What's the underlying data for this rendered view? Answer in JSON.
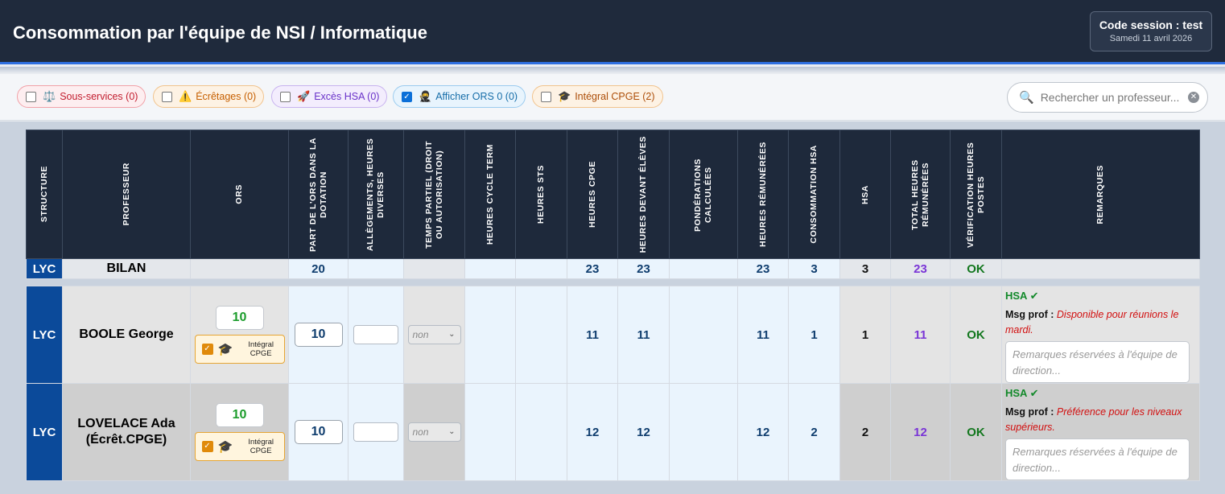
{
  "header": {
    "title": "Consommation par l'équipe de NSI / Informatique",
    "session_code": "Code session : test",
    "session_date": "Samedi 11 avril 2026"
  },
  "filters": [
    {
      "label": "Sous-services (0)",
      "icon": "balance-scale-icon",
      "checked": false,
      "color": "#c21d2e"
    },
    {
      "label": "Écrêtages (0)",
      "icon": "warning-icon",
      "checked": false,
      "color": "#c65f00"
    },
    {
      "label": "Excès HSA (0)",
      "icon": "rocket-icon",
      "checked": false,
      "color": "#6a32c9"
    },
    {
      "label": "Afficher ORS 0 (0)",
      "icon": "ninja-icon",
      "checked": true,
      "color": "#176ea9"
    },
    {
      "label": "Intégral CPGE (2)",
      "icon": "graduation-cap-icon",
      "checked": false,
      "color": "#ad4f0a"
    }
  ],
  "search": {
    "placeholder": "Rechercher un professeur..."
  },
  "columns": [
    "Structure",
    "Professeur",
    "ORS",
    "Part de l'ORS dans la dotation",
    "Allègements, heures diverses",
    "Temps partiel (droit ou autorisation)",
    "Heures cycle term",
    "Heures STS",
    "Heures CPGE",
    "Heures devant élèves",
    "Pondérations calculées",
    "Heures rémunérées",
    "Consommation HSA",
    "HSA",
    "Total heures rémunérées",
    "Vérification heures postes",
    "Remarques"
  ],
  "bilan": {
    "structure": "LYC",
    "label": "BILAN",
    "part_ors": "20",
    "heures_cpge": "23",
    "heures_devant": "23",
    "heures_remunerees": "23",
    "conso_hsa": "3",
    "hsa": "3",
    "total": "23",
    "verification": "OK"
  },
  "rows": [
    {
      "structure": "LYC",
      "professeur": "BOOLE George",
      "ors": "10",
      "cpge_label": "Intégral CPGE",
      "part_ors": "10",
      "temps_partiel": "non",
      "heures_cpge": "11",
      "heures_devant": "11",
      "heures_remunerees": "11",
      "conso_hsa": "1",
      "hsa": "1",
      "total": "11",
      "verification": "OK",
      "rem_hsa": "HSA ✔",
      "msg_label": "Msg prof :",
      "msg_text": "Disponible pour réunions le mardi.",
      "rem_placeholder": "Remarques réservées à l'équipe de direction..."
    },
    {
      "structure": "LYC",
      "professeur": "LOVELACE Ada (Écrêt.CPGE)",
      "ors": "10",
      "cpge_label": "Intégral CPGE",
      "part_ors": "10",
      "temps_partiel": "non",
      "heures_cpge": "12",
      "heures_devant": "12",
      "heures_remunerees": "12",
      "conso_hsa": "2",
      "hsa": "2",
      "total": "12",
      "verification": "OK",
      "rem_hsa": "HSA ✔",
      "msg_label": "Msg prof :",
      "msg_text": "Préférence pour les niveaux supérieurs.",
      "rem_placeholder": "Remarques réservées à l'équipe de direction..."
    }
  ]
}
